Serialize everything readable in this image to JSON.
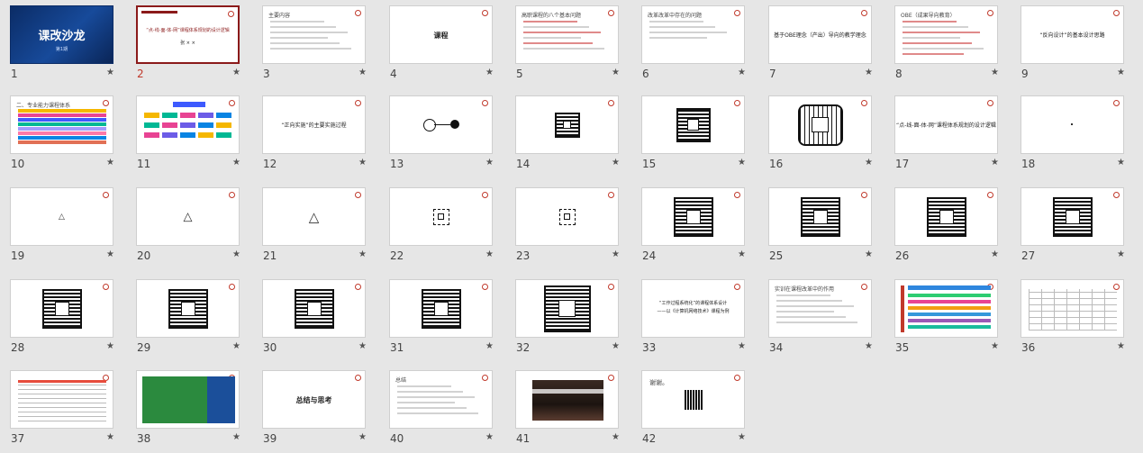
{
  "slides": [
    {
      "n": "1",
      "kind": "title-dark",
      "text": "课改沙龙",
      "sub": "第1期"
    },
    {
      "n": "2",
      "kind": "cover",
      "text": "“点-线-面-体-网”课程体系规划的设计逻辑",
      "sub": "张 × ×",
      "selected": true
    },
    {
      "n": "3",
      "kind": "outline",
      "title": "主要内容"
    },
    {
      "n": "4",
      "kind": "center-big",
      "text": "课程"
    },
    {
      "n": "5",
      "kind": "text-red",
      "title": "高职课程的八个基本问题"
    },
    {
      "n": "6",
      "kind": "text-list",
      "title": "改革改革中存在的问题"
    },
    {
      "n": "7",
      "kind": "center",
      "text": "基于OBE理念（产出）导向的教学理念"
    },
    {
      "n": "8",
      "kind": "text-para",
      "title": "OBE（成果导向教育）"
    },
    {
      "n": "9",
      "kind": "center",
      "text": "“反向设计”的基本设计思路"
    },
    {
      "n": "10",
      "kind": "color-bars",
      "title": "二、专业能力课程体系"
    },
    {
      "n": "11",
      "kind": "org-chart"
    },
    {
      "n": "12",
      "kind": "center",
      "text": "“正向实施”的主要实施过程"
    },
    {
      "n": "13",
      "kind": "node"
    },
    {
      "n": "14",
      "kind": "mandala-s"
    },
    {
      "n": "15",
      "kind": "mandala-m"
    },
    {
      "n": "16",
      "kind": "mandala-r"
    },
    {
      "n": "17",
      "kind": "center",
      "text": "“点-线-面-体-网”课程体系规划的设计逻辑"
    },
    {
      "n": "18",
      "kind": "dot"
    },
    {
      "n": "19",
      "kind": "tri-s"
    },
    {
      "n": "20",
      "kind": "tri-m"
    },
    {
      "n": "21",
      "kind": "tri-l"
    },
    {
      "n": "22",
      "kind": "mandala-xs"
    },
    {
      "n": "23",
      "kind": "mandala-xs"
    },
    {
      "n": "24",
      "kind": "mandala-l"
    },
    {
      "n": "25",
      "kind": "mandala-l"
    },
    {
      "n": "26",
      "kind": "mandala-l"
    },
    {
      "n": "27",
      "kind": "mandala-l"
    },
    {
      "n": "28",
      "kind": "mandala-l"
    },
    {
      "n": "29",
      "kind": "mandala-l"
    },
    {
      "n": "30",
      "kind": "mandala-l"
    },
    {
      "n": "31",
      "kind": "mandala-l"
    },
    {
      "n": "32",
      "kind": "mandala-xl"
    },
    {
      "n": "33",
      "kind": "center2",
      "text": "“工作过程系统化”的课程体系设计",
      "sub": "——以《计算机网络技术》课程为例"
    },
    {
      "n": "34",
      "kind": "outline",
      "title": "实训在课程改革中的作用"
    },
    {
      "n": "35",
      "kind": "flow-colors"
    },
    {
      "n": "36",
      "kind": "table"
    },
    {
      "n": "37",
      "kind": "table-text"
    },
    {
      "n": "38",
      "kind": "green-blue"
    },
    {
      "n": "39",
      "kind": "center-big",
      "text": "总结与思考"
    },
    {
      "n": "40",
      "kind": "outline",
      "title": "总结"
    },
    {
      "n": "41",
      "kind": "photo"
    },
    {
      "n": "42",
      "kind": "thanks",
      "text": "谢谢。"
    }
  ],
  "star_glyph": "★",
  "colors": {
    "selected_border": "#8b1a1a",
    "selected_number": "#c0392b",
    "seal": "#c0392b"
  }
}
